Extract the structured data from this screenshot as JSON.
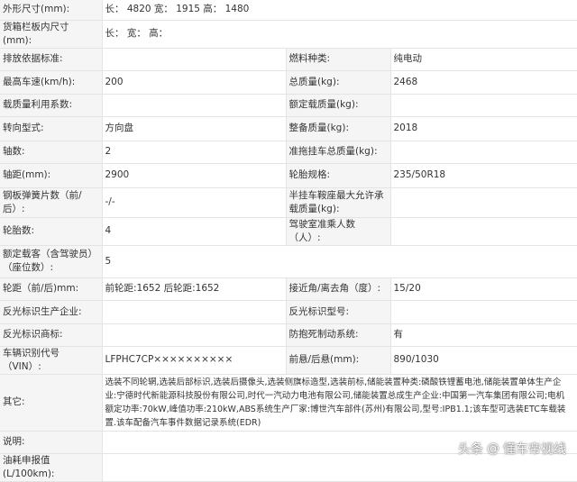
{
  "spec": {
    "dims_label": "外形尺寸(mm):",
    "dims_value": "长： 4820 宽： 1915 高： 1480",
    "cargo_label": "货箱栏板内尺寸(mm):",
    "cargo_value": "长： 宽： 高：",
    "emission_label": "排放依据标准:",
    "emission_value": "",
    "fuel_label": "燃料种类:",
    "fuel_value": "纯电动",
    "speed_label": "最高车速(km/h):",
    "speed_value": "200",
    "mass_label": "总质量(kg):",
    "mass_value": "2468",
    "loadfactor_label": "载质量利用系数:",
    "loadfactor_value": "",
    "ratedload_label": "额定载质量(kg):",
    "ratedload_value": "",
    "steering_label": "转向型式:",
    "steering_value": "方向盘",
    "curb_label": "整备质量(kg):",
    "curb_value": "2018",
    "axles_label": "轴数:",
    "axles_value": "2",
    "trailer_label": "准拖挂车总质量(kg):",
    "trailer_value": "",
    "wheelbase_label": "轴距(mm):",
    "wheelbase_value": "2900",
    "tire_label": "轮胎规格:",
    "tire_value": "235/50R18",
    "spring_label": "钢板弹簧片数（前/后）:",
    "spring_value": "-/-",
    "saddle_label": "半挂车鞍座最大允许承载质量(kg):",
    "saddle_value": "",
    "tirecount_label": "轮胎数:",
    "tirecount_value": "4",
    "cab_label": "驾驶室准乘人数（人）:",
    "cab_value": "",
    "seats_label": "额定载客（含驾驶员）（座位数）:",
    "seats_value": "5",
    "track_label": "轮距（前/后)mm:",
    "track_value": "前轮距:1652 后轮距:1652",
    "angle_label": "接近角/离去角（度）:",
    "angle_value": "15/20",
    "reflector_maker_label": "反光标识生产企业:",
    "reflector_maker_value": "",
    "reflector_model_label": "反光标识型号:",
    "reflector_model_value": "",
    "reflector_brand_label": "反光标识商标:",
    "reflector_brand_value": "",
    "abs_label": "防抱死制动系统:",
    "abs_value": "有",
    "vin_label": "车辆识别代号（VIN）:",
    "vin_value": "LFPHC7CP××××××××××",
    "overhang_label": "前悬/后悬(mm):",
    "overhang_value": "890/1030",
    "other_label": "其它:",
    "other_value": "选装不同轮辋,选装后部标识,选装后摄像头,选装侧旗标造型,选装前标,储能装置种类:磷酸铁锂蓄电池,储能装置单体生产企业:宁德时代新能源科技股份有限公司,时代一汽动力电池有限公司,储能装置总成生产企业:中国第一汽车集团有限公司;电机额定功率:70kW,峰值功率:210kW,ABS系统生产厂家:博世汽车部件(苏州)有限公司,型号:IPB1.1;该车型可选装ETC车载装置.该车配备汽车事件数据记录系统(EDR)",
    "note_label": "说明:",
    "note_value": "",
    "fuelcons_label": "油耗申报值(L/100km):",
    "fuelcons_value": ""
  },
  "watermark": {
    "brand": "头条",
    "separator": "@",
    "account": "懂车帝视线",
    "text_color": "#ffffff"
  },
  "colors": {
    "label_bg": "#f5f5f5",
    "value_bg": "#ffffff",
    "border": "#e4e4e4",
    "text": "#333333"
  }
}
